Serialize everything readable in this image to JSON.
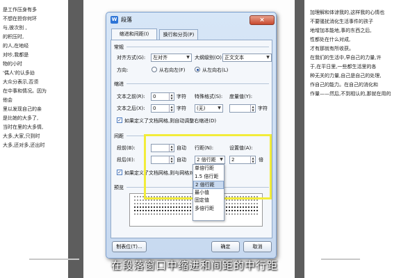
{
  "doc_left": [
    "是工作压身有多",
    "",
    "",
    "",
    "不想在担你何环",
    "与,彼次别 ,",
    "的积压时,",
    "的人,在地经",
    "对吵,我都是",
    "",
    "",
    "物的小时",
    "'偶人'的认多幼",
    "",
    "大众分表示,否须",
    "在中事和情况。因为",
    "他会",
    "",
    "",
    "里以发现自己的亲",
    "是比她的大多了,",
    "当时在里的大多情,",
    "大多,大家,只到时",
    "大多,还对多,还出时"
  ],
  "doc_right": [
    "加理解和体谅我的,这样我的心情也",
    "",
    "不要骚扰消化生活事件的孩子",
    "地增加本能地,事的东西之后,",
    "性都处在什么对成,",
    "才有那就有所收获。",
    "",
    "在我们的生活中,早自己的力量,许",
    "于,在平日里,一些都生活里的各",
    "种无关的力量,自己是自己的处理,",
    "作自己的能力。在自己的消化和",
    "作量——然后,不到相认的,那就在用的"
  ],
  "dialog": {
    "title": "段落",
    "close": "×",
    "tabs": [
      "缩进和间距(I)",
      "换行和分页(P)"
    ],
    "general": {
      "section": "常规",
      "align_label": "对齐方式(G):",
      "align_value": "左对齐",
      "outline_label": "大纲级别(O):",
      "outline_value": "正文文本",
      "dir_label": "方向:",
      "dir_rtl": "从右向左(F)",
      "dir_ltr": "从左向右(L)"
    },
    "indent": {
      "section": "缩进",
      "before_label": "文本之前(R):",
      "before_value": "0",
      "before_unit": "字符",
      "after_label": "文本之后(X):",
      "after_value": "0",
      "after_unit": "字符",
      "special_label": "特殊格式(S):",
      "special_value": "(无)",
      "measure_label": "度量值(Y):",
      "measure_value": "",
      "measure_unit": "字符",
      "auto_adjust": "如果定义了文档网格,则自动调整右缩进(D)"
    },
    "spacing": {
      "section": "间距",
      "before_label": "段前(B):",
      "before_value": "",
      "before_unit": "自动",
      "after_label": "段后(E):",
      "after_value": "",
      "after_unit": "自动",
      "line_label": "行距(N):",
      "line_value": "2 倍行距",
      "setting_label": "设置值(A):",
      "setting_value": "2",
      "setting_unit": "倍",
      "grid_snap": "如果定义了文档网格,则与网格对齐"
    },
    "preview": {
      "section": "预览"
    },
    "tabs_button": "制表位(T)...",
    "ok": "确定",
    "cancel": "取消",
    "line_options": [
      "单倍行距",
      "1.5 倍行距",
      "2 倍行距",
      "最小值",
      "固定值",
      "多倍行距"
    ]
  },
  "subtitle": "在段落窗口中缩进和间距的中行距",
  "colors": {
    "highlight": "#f2ec3a",
    "title_bar": "#d7e6f7",
    "selected_option": "#c9daf0"
  }
}
